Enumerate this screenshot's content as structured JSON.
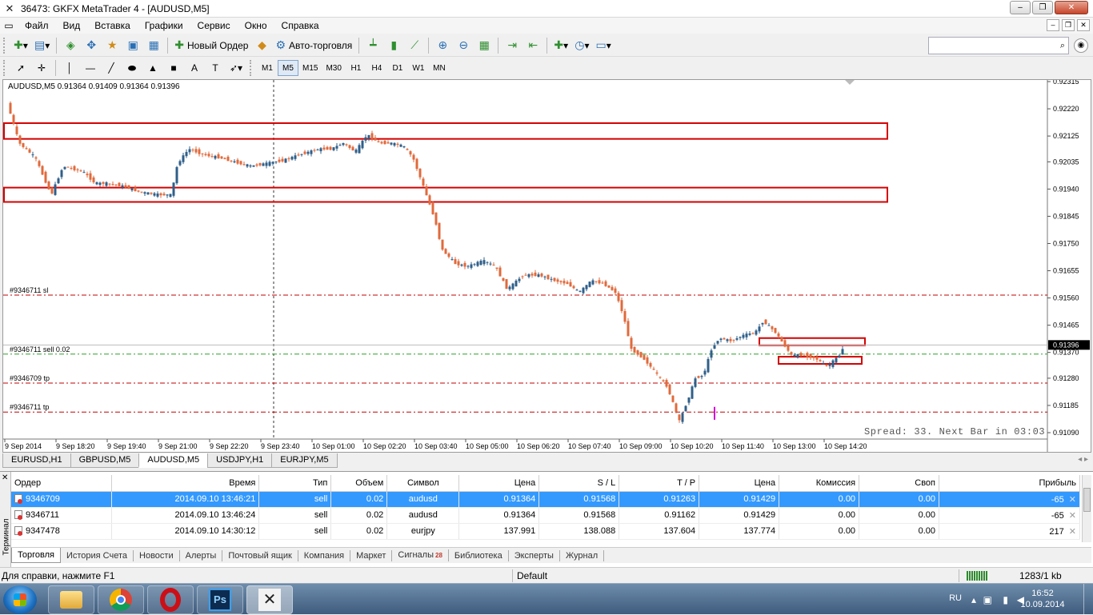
{
  "window": {
    "title": "36473: GKFX MetaTrader 4 - [AUDUSD,M5]",
    "buttons": [
      "‒",
      "❐",
      "✕"
    ]
  },
  "menu": {
    "items": [
      "Файл",
      "Вид",
      "Вставка",
      "Графики",
      "Сервис",
      "Окно",
      "Справка"
    ]
  },
  "toolbar": {
    "new_order_label": "Новый Ордер",
    "autotrade_label": "Авто-торговля",
    "timeframes": [
      "M1",
      "M5",
      "M15",
      "M30",
      "H1",
      "H4",
      "D1",
      "W1",
      "MN"
    ],
    "active_timeframe": "M5",
    "search_value": "",
    "search_placeholder": ""
  },
  "chart": {
    "symbol_header": "AUDUSD,M5  0.91364 0.91409 0.91364 0.91396",
    "spread_text": "Spread: 33. Next Bar in 03:03",
    "colors": {
      "bull": "#2f5f8a",
      "bear": "#e06a3c",
      "zone": "#d40000",
      "sl": "#c00000",
      "open": "#2ca02c",
      "current": "#000000"
    },
    "current_price": "0.91396",
    "price_axis": [
      "0.92315",
      "0.92220",
      "0.92125",
      "0.92035",
      "0.91940",
      "0.91845",
      "0.91750",
      "0.91655",
      "0.91560",
      "0.91465",
      "0.91370",
      "0.91280",
      "0.91185",
      "0.91090"
    ],
    "time_axis": [
      "9 Sep 2014",
      "9 Sep 18:20",
      "9 Sep 19:40",
      "9 Sep 21:00",
      "9 Sep 22:20",
      "9 Sep 23:40",
      "10 Sep 01:00",
      "10 Sep 02:20",
      "10 Sep 03:40",
      "10 Sep 05:00",
      "10 Sep 06:20",
      "10 Sep 07:40",
      "10 Sep 09:00",
      "10 Sep 10:20",
      "10 Sep 11:40",
      "10 Sep 13:00",
      "10 Sep 14:20"
    ],
    "levels": [
      {
        "label": "#9346711 sl",
        "price": 0.9157,
        "kind": "sl"
      },
      {
        "label": "#9346711 sell 0.02",
        "price": 0.91364,
        "kind": "open"
      },
      {
        "label": "#9346709 tp",
        "price": 0.91263,
        "kind": "sl"
      },
      {
        "label": "#9346711 tp",
        "price": 0.91162,
        "kind": "sl"
      }
    ]
  },
  "chart_tabs": [
    "EURUSD,H1",
    "GBPUSD,M5",
    "AUDUSD,M5",
    "USDJPY,H1",
    "EURJPY,M5"
  ],
  "chart_tab_active": "AUDUSD,M5",
  "orders": {
    "columns": [
      "Ордер",
      "Время",
      "Тип",
      "Объем",
      "Символ",
      "Цена",
      "S / L",
      "T / P",
      "Цена",
      "Комиссия",
      "Своп",
      "Прибыль"
    ],
    "rows": [
      [
        "9346709",
        "2014.09.10 13:46:21",
        "sell",
        "0.02",
        "audusd",
        "0.91364",
        "0.91568",
        "0.91263",
        "0.91429",
        "0.00",
        "0.00",
        "-65"
      ],
      [
        "9346711",
        "2014.09.10 13:46:24",
        "sell",
        "0.02",
        "audusd",
        "0.91364",
        "0.91568",
        "0.91162",
        "0.91429",
        "0.00",
        "0.00",
        "-65"
      ],
      [
        "9347478",
        "2014.09.10 14:30:12",
        "sell",
        "0.02",
        "eurjpy",
        "137.991",
        "138.088",
        "137.604",
        "137.774",
        "0.00",
        "0.00",
        "217"
      ]
    ]
  },
  "terminal_label": "Терминал",
  "terminal_tabs": [
    {
      "label": "Торговля",
      "badge": ""
    },
    {
      "label": "История Счета",
      "badge": ""
    },
    {
      "label": "Новости",
      "badge": ""
    },
    {
      "label": "Алерты",
      "badge": ""
    },
    {
      "label": "Почтовый ящик",
      "badge": ""
    },
    {
      "label": "Компания",
      "badge": ""
    },
    {
      "label": "Маркет",
      "badge": ""
    },
    {
      "label": "Сигналы",
      "badge": "28"
    },
    {
      "label": "Библиотека",
      "badge": ""
    },
    {
      "label": "Эксперты",
      "badge": ""
    },
    {
      "label": "Журнал",
      "badge": ""
    }
  ],
  "status": {
    "help": "Для справки, нажмите F1",
    "profile": "Default",
    "traffic": "1283/1 kb"
  },
  "taskbar": {
    "lang": "RU",
    "time": "16:52",
    "date": "10.09.2014"
  }
}
